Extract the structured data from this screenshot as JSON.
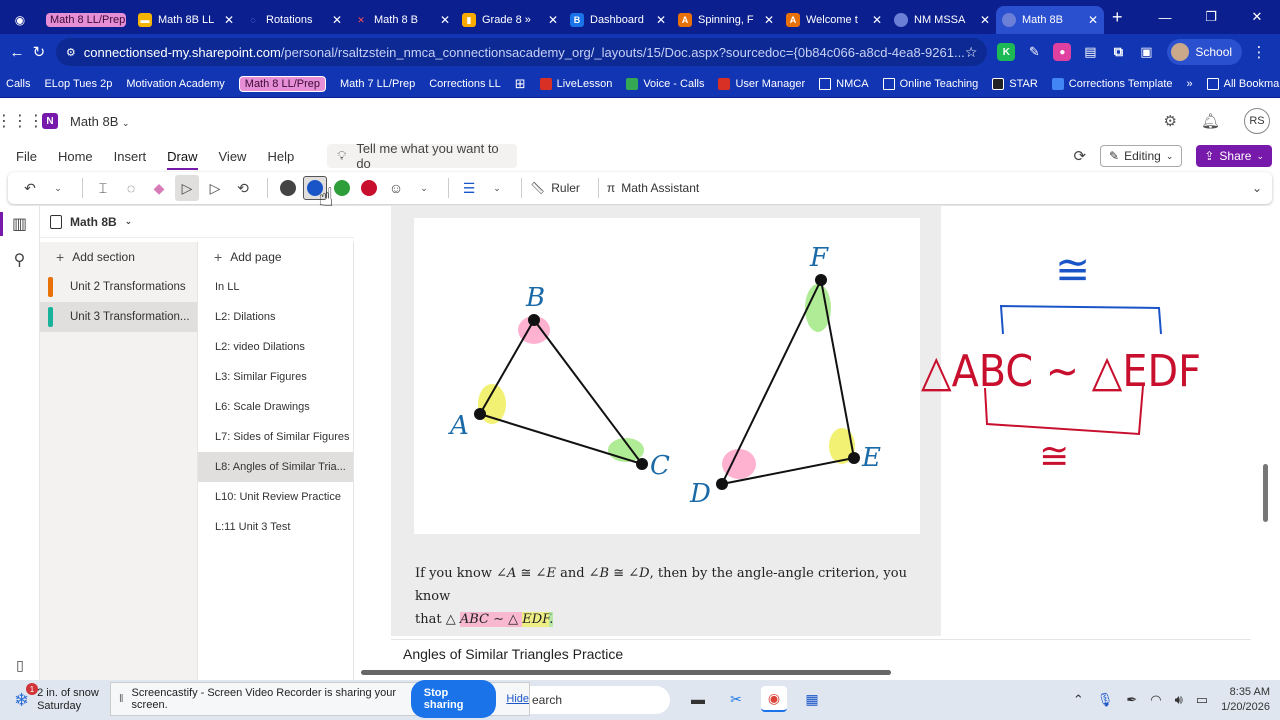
{
  "browser": {
    "tabs": [
      {
        "label": "Math 8 LL/Prep",
        "type": "group",
        "color": "#e78fd6"
      },
      {
        "label": "Math 8B LL",
        "icon": "M",
        "color": "#f4b400"
      },
      {
        "label": "Rotations",
        "icon": "◌",
        "color": "#4a90d9"
      },
      {
        "label": "Math 8 B",
        "icon": "✕",
        "color": "#d93025"
      },
      {
        "label": "Grade 8 »",
        "icon": "▮",
        "color": "#f9ab00"
      },
      {
        "label": "Dashboard",
        "icon": "B",
        "color": "#1a73e8"
      },
      {
        "label": "Spinning, F",
        "icon": "A",
        "color": "#e8710a"
      },
      {
        "label": "Welcome t",
        "icon": "A",
        "color": "#e8710a"
      },
      {
        "label": "NM MSSA",
        "icon": "",
        "color": "#6b7fd7"
      },
      {
        "label": "Math 8B",
        "icon": "",
        "color": "#6b7fd7",
        "active": true
      }
    ],
    "url_host": "connectionsed-my.sharepoint.com",
    "url_path": "/personal/rsaltzstein_nmca_connectionsacademy_org/_layouts/15/Doc.aspx?sourcedoc={0b84c066-a8cd-4ea8-9261...",
    "profile_label": "School",
    "bookmarks": [
      {
        "label": "Calls",
        "kind": "plain"
      },
      {
        "label": "ELop Tues 2p",
        "kind": "plain"
      },
      {
        "label": "Motivation Academy",
        "kind": "plain"
      },
      {
        "label": "Math 8 LL/Prep",
        "kind": "pill"
      },
      {
        "label": "Math 7 LL/Prep",
        "kind": "plain"
      },
      {
        "label": "Corrections LL",
        "kind": "plain"
      },
      {
        "label": "LiveLesson",
        "kind": "icon",
        "color": "#d93025"
      },
      {
        "label": "Voice - Calls",
        "kind": "icon",
        "color": "#34a853"
      },
      {
        "label": "User Manager",
        "kind": "icon",
        "color": "#d93025"
      },
      {
        "label": "NMCA",
        "kind": "folder"
      },
      {
        "label": "Online Teaching",
        "kind": "folder"
      },
      {
        "label": "STAR",
        "kind": "icon",
        "color": "#222"
      },
      {
        "label": "Corrections Template",
        "kind": "icon",
        "color": "#4285f4"
      }
    ],
    "all_bookmarks": "All Bookmarks"
  },
  "onenote": {
    "title": "Math 8B",
    "user_initials": "RS",
    "menu": [
      "File",
      "Home",
      "Insert",
      "Draw",
      "View",
      "Help"
    ],
    "active_menu": "Draw",
    "tell_me": "Tell me what you want to do",
    "editing_label": "Editing",
    "share_label": "Share",
    "ribbon": {
      "pens": [
        "#444444",
        "#1a55c8",
        "#2e9e3a",
        "#c8102e"
      ],
      "ruler": "Ruler",
      "math_assistant": "Math Assistant"
    },
    "notebook": "Math 8B",
    "add_section": "Add section",
    "add_page": "Add page",
    "sections": [
      {
        "label": "Unit 2 Transformations",
        "color": "#e8710a"
      },
      {
        "label": "Unit 3 Transformation...",
        "color": "#19b39b",
        "selected": true
      }
    ],
    "pages": [
      {
        "label": "In LL"
      },
      {
        "label": "L2: Dilations"
      },
      {
        "label": "L2: video Dilations"
      },
      {
        "label": "L3: Similar Figures"
      },
      {
        "label": "L6: Scale Drawings"
      },
      {
        "label": "L7: Sides of Similar Figures"
      },
      {
        "label": "L8: Angles of Similar Tria...",
        "selected": true
      },
      {
        "label": "L10: Unit Review Practice"
      },
      {
        "label": "L:11 Unit 3 Test"
      }
    ]
  },
  "page": {
    "labels": {
      "A": "A",
      "B": "B",
      "C": "C",
      "D": "D",
      "E": "E",
      "F": "F"
    },
    "text_1": "If you know ∠",
    "a1": "A",
    "t2": " ≅ ∠",
    "a2": "E",
    "t3": " and ∠",
    "a3": "B",
    "t4": " ≅ ∠",
    "a4": "D",
    "t5": ", then by the angle-angle criterion, you know",
    "t6": "that △ ",
    "h1": "ABC",
    "t7": " ∼ △ ",
    "h2": "EDF",
    "t8": ".",
    "practice_title": "Angles of Similar Triangles Practice",
    "ink_cong_top": "≅",
    "ink_cong_bottom": "≅",
    "ink_statement": "△ABC ∼ △EDF"
  },
  "taskbar": {
    "weather_line1": "2 in. of snow",
    "weather_line2": "Saturday",
    "weather_badge": "1",
    "share_text": "Screencastify - Screen Video Recorder is sharing your screen.",
    "stop_label": "Stop sharing",
    "hide_label": "Hide",
    "search": "earch",
    "time": "8:35 AM",
    "date": "1/20/2026"
  }
}
